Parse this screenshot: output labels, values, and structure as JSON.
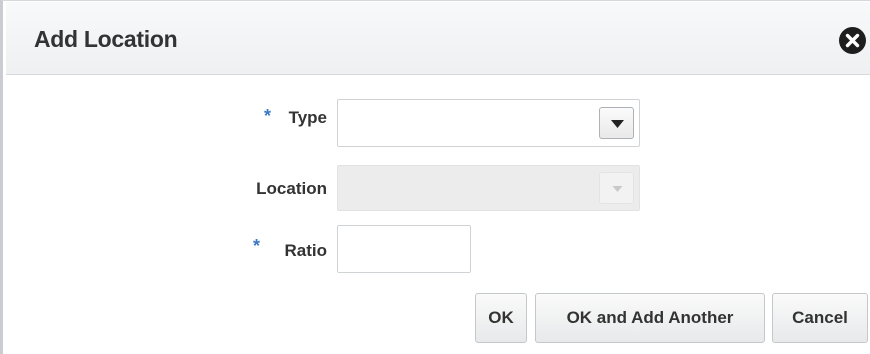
{
  "dialog": {
    "title": "Add Location",
    "close_icon": "close-circle-icon"
  },
  "form": {
    "type": {
      "label": "Type",
      "required_marker": "*",
      "value": ""
    },
    "location": {
      "label": "Location",
      "value": "",
      "disabled": true
    },
    "ratio": {
      "label": "Ratio",
      "required_marker": "*",
      "value": ""
    }
  },
  "buttons": {
    "ok": "OK",
    "ok_add_another": "OK and Add Another",
    "cancel": "Cancel"
  },
  "colors": {
    "required_marker": "#3a78c6",
    "text": "#333333",
    "disabled_field": "#ececec"
  }
}
